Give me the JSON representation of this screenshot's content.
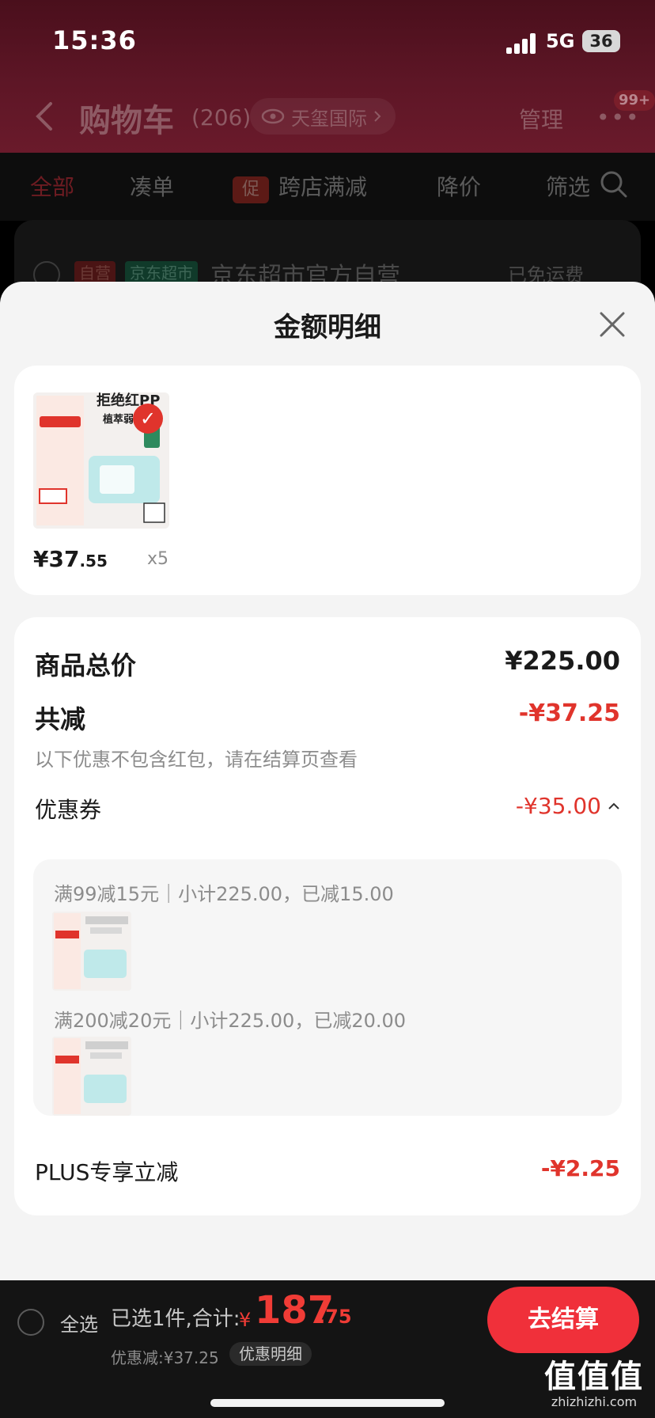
{
  "status_bar": {
    "time": "15:36",
    "network": "5G",
    "battery": "36"
  },
  "navbar": {
    "title": "购物车",
    "count": "(206)",
    "address": "天玺国际",
    "manage": "管理",
    "badge": "99+"
  },
  "filters": [
    {
      "label": "全部",
      "active": true
    },
    {
      "label": "凑单"
    },
    {
      "label": "跨店满减",
      "tag": "促"
    },
    {
      "label": "降价"
    },
    {
      "label": "筛选"
    }
  ],
  "store": {
    "tag_self": "自营",
    "tag_market": "京东超市",
    "name": "京东超市官方自营",
    "shipping": "已免运费"
  },
  "sheet": {
    "title": "金额明细",
    "product": {
      "price_int": "¥37",
      "price_dec": ".55",
      "qty": "x5",
      "image_headline": "拒绝红PP",
      "image_subline": "植萃弱酸"
    },
    "total": {
      "label": "商品总价",
      "value": "¥225.00"
    },
    "reduce": {
      "label": "共减",
      "value": "-¥37.25",
      "note": "以下优惠不包含红包，请在结算页查看"
    },
    "coupon": {
      "label": "优惠券",
      "value": "-¥35.00",
      "items": [
        {
          "text": "满99减15元｜小计225.00，已减15.00"
        },
        {
          "text": "满200减20元｜小计225.00，已减20.00"
        }
      ]
    },
    "plus": {
      "label": "PLUS专享立减",
      "value": "-¥2.25"
    }
  },
  "checkout": {
    "select_all": "全选",
    "selected": "已选1件,合计:",
    "yen": "¥",
    "total_int": "187",
    "total_dec": ".75",
    "discount": "优惠减:¥37.25",
    "detail_chip": "优惠明细",
    "button": "去结算"
  },
  "watermark": {
    "glyphs": "值值值",
    "url": "zhizhizhi.com"
  },
  "colors": {
    "accent_red": "#e0342c",
    "checkout_red": "#f0303a",
    "sheet_bg": "#f4f4f4"
  }
}
